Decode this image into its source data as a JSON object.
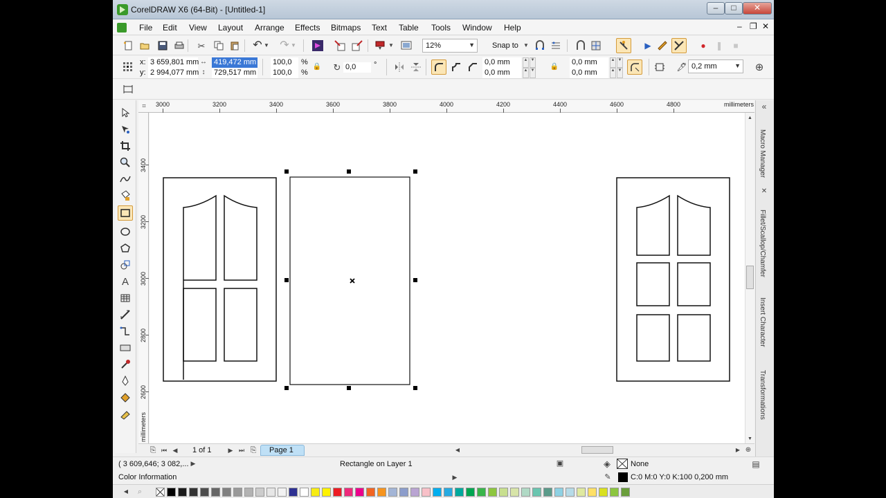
{
  "window": {
    "title": "CorelDRAW X6 (64-Bit) - [Untitled-1]",
    "minimize": "–",
    "maximize": "□",
    "close": "✕",
    "inner_minimize": "–",
    "inner_restore": "❐",
    "inner_close": "✕"
  },
  "menu": [
    "File",
    "Edit",
    "View",
    "Layout",
    "Arrange",
    "Effects",
    "Bitmaps",
    "Text",
    "Table",
    "Tools",
    "Window",
    "Help"
  ],
  "standard_toolbar": {
    "zoom_level": "12%",
    "snap_to_label": "Snap to",
    "icons": [
      "new-icon",
      "open-icon",
      "save-icon",
      "print-icon",
      "cut-icon",
      "copy-icon",
      "paste-icon",
      "undo-icon",
      "redo-icon",
      "search-content-icon",
      "import-icon",
      "export-icon",
      "publish-to-pdf-icon",
      "full-screen-preview-icon",
      "snap-options-icon",
      "options-icon",
      "run-macro-icon",
      "record-macro-icon",
      "stop-macro-icon"
    ]
  },
  "property_bar": {
    "x_label": "x:",
    "x_value": "3 659,801 mm",
    "y_label": "y:",
    "y_value": "2 994,077 mm",
    "width_value": "419,472 mm",
    "height_value": "729,517 mm",
    "scale_x": "100,0",
    "scale_y": "100,0",
    "percent_sign": "%",
    "rotation_value": "0,0",
    "degree_sign": "°",
    "corner_tl": "0,0 mm",
    "corner_bl": "0,0 mm",
    "corner_tr": "0,0 mm",
    "corner_br": "0,0 mm",
    "outline_width": "0,2 mm"
  },
  "rulers": {
    "units": "millimeters",
    "horizontal_ticks": [
      "3000",
      "3200",
      "3400",
      "3600",
      "3800",
      "4000",
      "4200",
      "4400",
      "4600",
      "4800"
    ],
    "vertical_ticks": [
      "3400",
      "3200",
      "3000",
      "2800",
      "2600"
    ]
  },
  "dockers": {
    "tabs": [
      "Macro Manager",
      "Fillet/Scallop/Chamfer",
      "Insert Character",
      "Transformations"
    ]
  },
  "page_navigator": {
    "page_count": "1 of 1",
    "page_tab": "Page 1"
  },
  "status_bar": {
    "cursor_position": "( 3 609,646; 3 082,... ",
    "selection_info": "Rectangle on Layer 1",
    "fill_label": "None",
    "outline_info": "C:0 M:0 Y:0 K:100  0,200 mm",
    "color_info_label": "Color Information"
  },
  "palette": {
    "colors": [
      "#ffffff",
      "#000000",
      "#1a1a1a",
      "#333333",
      "#4d4d4d",
      "#666666",
      "#808080",
      "#999999",
      "#b3b3b3",
      "#cccccc",
      "#e6e6e6",
      "#f2f2f2",
      "#2e3192",
      "#ffffff",
      "#f7ec13",
      "#fff200",
      "#ed1c24",
      "#ee2a7b",
      "#ec008c",
      "#f26522",
      "#f7941d",
      "#a3b5d6",
      "#8c9dcb",
      "#b9a4d2",
      "#f8c0c8",
      "#00aeef",
      "#27aae1",
      "#00a99d",
      "#00a651",
      "#39b54a",
      "#8dc63f",
      "#c8df8f",
      "#d7e4a8",
      "#b0d9c5",
      "#6bc5b0",
      "#5b9b8a",
      "#8ed1e3",
      "#b6dbe8",
      "#dfe9a0",
      "#ffe066",
      "#d9e021",
      "#8cc63f",
      "#6a9e3b"
    ]
  }
}
